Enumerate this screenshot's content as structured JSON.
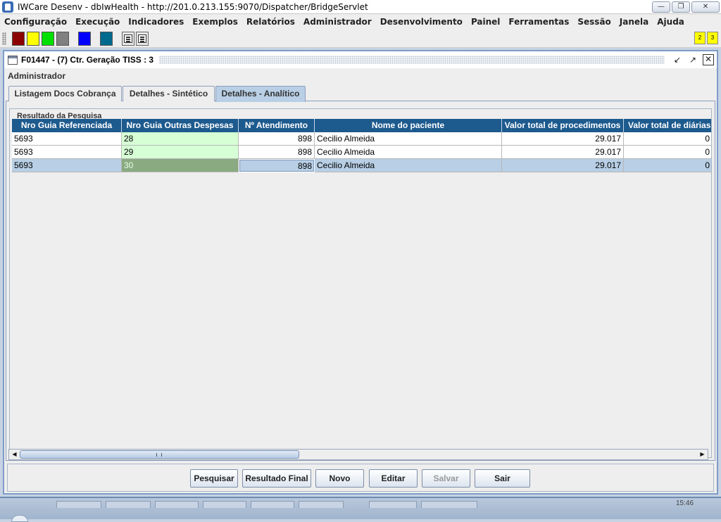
{
  "window": {
    "title": "IWCare Desenv - dbIwHealth - http://201.0.213.155:9070/Dispatcher/BridgeServlet",
    "controls": [
      "minimize",
      "maximize",
      "close"
    ]
  },
  "menubar": {
    "items": [
      "Configuração",
      "Execução",
      "Indicadores",
      "Exemplos",
      "Relatórios",
      "Administrador",
      "Desenvolvimento",
      "Painel",
      "Ferramentas",
      "Sessão",
      "Janela",
      "Ajuda"
    ]
  },
  "toolbar": {
    "swatch_colors": [
      "#8b0000",
      "#ffff00",
      "#00e000",
      "#808080",
      "#0000ff",
      "#006a8e"
    ],
    "badges": [
      "2",
      "3"
    ]
  },
  "frame": {
    "title": "F01447 - (7) Ctr. Geração TISS : 3",
    "section_label": "Administrador",
    "tabs": [
      {
        "label": "Listagem Docs Cobrança",
        "active": false
      },
      {
        "label": "Detalhes - Sintético",
        "active": false
      },
      {
        "label": "Detalhes - Analítico",
        "active": true
      }
    ],
    "group_label": "Resultado da Pesquisa"
  },
  "table": {
    "columns": [
      "Nro Guia Referenciada",
      "Nro Guia Outras Despesas",
      "Nº Atendimento",
      "Nome do paciente",
      "Valor total de procedimentos",
      "Valor total de diárias"
    ],
    "rows": [
      {
        "guia_ref": "5693",
        "guia_outras": "28",
        "atendimento": "898",
        "paciente": "Cecilio Almeida",
        "valor_proc": "29.017",
        "valor_diarias": "0",
        "selected": false
      },
      {
        "guia_ref": "5693",
        "guia_outras": "29",
        "atendimento": "898",
        "paciente": "Cecilio Almeida",
        "valor_proc": "29.017",
        "valor_diarias": "0",
        "selected": false
      },
      {
        "guia_ref": "5693",
        "guia_outras": "30",
        "atendimento": "898",
        "paciente": "Cecilio Almeida",
        "valor_proc": "29.017",
        "valor_diarias": "0",
        "selected": true
      }
    ]
  },
  "buttons": [
    {
      "label": "Pesquisar",
      "enabled": true
    },
    {
      "label": "Resultado Final",
      "enabled": true
    },
    {
      "label": "Novo",
      "enabled": true
    },
    {
      "label": "Editar",
      "enabled": true
    },
    {
      "label": "Salvar",
      "enabled": false
    },
    {
      "label": "Sair",
      "enabled": true
    }
  ],
  "taskbar": {
    "clock": "15:46"
  }
}
